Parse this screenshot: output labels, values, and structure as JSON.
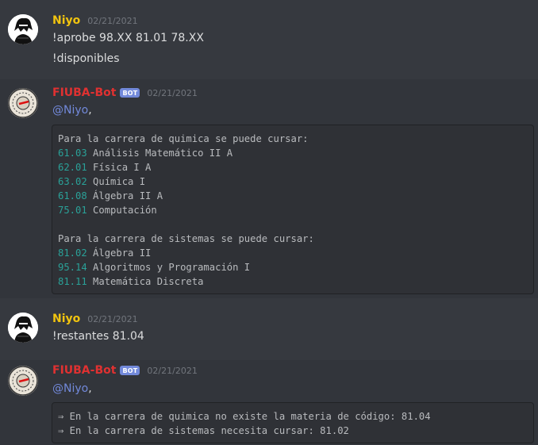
{
  "messages": [
    {
      "author": "Niyo",
      "timestamp": "02/21/2021",
      "lines": [
        "!aprobe 98.XX 81.01 78.XX",
        "!disponibles"
      ]
    },
    {
      "author": "FIUBA-Bot",
      "badge": "BOT",
      "timestamp": "02/21/2021",
      "mention": "@Niyo",
      "mention_suffix": ",",
      "code_lines": [
        {
          "code": "",
          "text": "Para la carrera de quimica se puede cursar:"
        },
        {
          "code": "61.03",
          "text": " Análisis Matemático II A"
        },
        {
          "code": "62.01",
          "text": " Física I A"
        },
        {
          "code": "63.02",
          "text": " Química I"
        },
        {
          "code": "61.08",
          "text": " Álgebra II A"
        },
        {
          "code": "75.01",
          "text": " Computación"
        },
        {
          "code": "",
          "text": ""
        },
        {
          "code": "",
          "text": "Para la carrera de sistemas se puede cursar:"
        },
        {
          "code": "81.02",
          "text": " Álgebra II"
        },
        {
          "code": "95.14",
          "text": " Algoritmos y Programación I"
        },
        {
          "code": "81.11",
          "text": " Matemática Discreta"
        }
      ]
    },
    {
      "author": "Niyo",
      "timestamp": "02/21/2021",
      "lines": [
        "!restantes 81.04"
      ]
    },
    {
      "author": "FIUBA-Bot",
      "badge": "BOT",
      "timestamp": "02/21/2021",
      "mention": "@Niyo",
      "mention_suffix": ",",
      "code_lines": [
        {
          "text": "⇒ En la carrera de quimica no existe la materia de código: 81.04"
        },
        {
          "text": "⇒ En la carrera de sistemas necesita cursar: 81.02"
        }
      ]
    }
  ],
  "colors": {
    "background": "#36393f",
    "user_name": "#f1c40f",
    "bot_name": "#e03131",
    "bot_badge": "#7289da",
    "mention": "#7289da",
    "code_number": "#2aa198"
  }
}
